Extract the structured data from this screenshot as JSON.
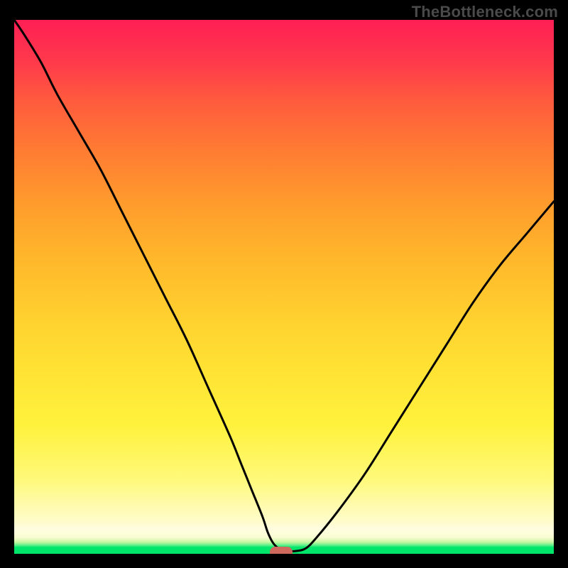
{
  "watermark": "TheBottleneck.com",
  "chart_data": {
    "type": "line",
    "title": "",
    "xlabel": "",
    "ylabel": "",
    "xlim": [
      0,
      100
    ],
    "ylim": [
      0,
      100
    ],
    "grid": false,
    "legend": false,
    "series": [
      {
        "name": "bottleneck-curve",
        "x": [
          0,
          2,
          5,
          8,
          12,
          16,
          20,
          24,
          28,
          32,
          36,
          40,
          42,
          44,
          46,
          47,
          48,
          49,
          50,
          52,
          54,
          56,
          60,
          65,
          70,
          75,
          80,
          85,
          90,
          95,
          100
        ],
        "values": [
          100,
          97,
          92,
          86,
          79,
          72,
          64,
          56,
          48,
          40,
          31,
          22,
          17,
          12,
          7,
          4,
          2,
          1,
          0.5,
          0.5,
          1,
          3,
          8,
          15,
          23,
          31,
          39,
          47,
          54,
          60,
          66
        ]
      }
    ],
    "marker": {
      "x": 49.5,
      "y": 0.3,
      "label": "optimal-point"
    },
    "background": {
      "type": "vertical-gradient",
      "stops": [
        {
          "pos": 0.0,
          "color": "#00e66a"
        },
        {
          "pos": 0.03,
          "color": "#f6fccf"
        },
        {
          "pos": 0.05,
          "color": "#fffde0"
        },
        {
          "pos": 0.25,
          "color": "#fff23d"
        },
        {
          "pos": 0.55,
          "color": "#ffb82b"
        },
        {
          "pos": 0.8,
          "color": "#ff6a38"
        },
        {
          "pos": 1.0,
          "color": "#ff1f55"
        }
      ]
    }
  }
}
